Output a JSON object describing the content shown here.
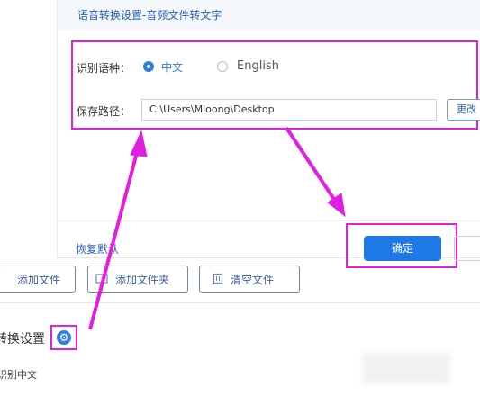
{
  "dialog": {
    "title": "语音转换设置-音频文件转文字",
    "language_label": "识别语种：",
    "language_options": [
      {
        "label": "中文",
        "selected": true
      },
      {
        "label": "English",
        "selected": false
      }
    ],
    "path_label": "保存路径：",
    "path_value": "C:\\Users\\Mloong\\Desktop",
    "change_label": "更改",
    "reset_label": "恢复默认",
    "ok_label": "确定"
  },
  "toolbar": {
    "add_file": "添加文件",
    "add_folder": "添加文件夹",
    "clear_files": "清空文件"
  },
  "settings": {
    "title": "转换设置",
    "current_language": "识别中文"
  },
  "colors": {
    "accent": "#1e78e6",
    "highlight": "#e21ee0",
    "link": "#2b63b5"
  }
}
